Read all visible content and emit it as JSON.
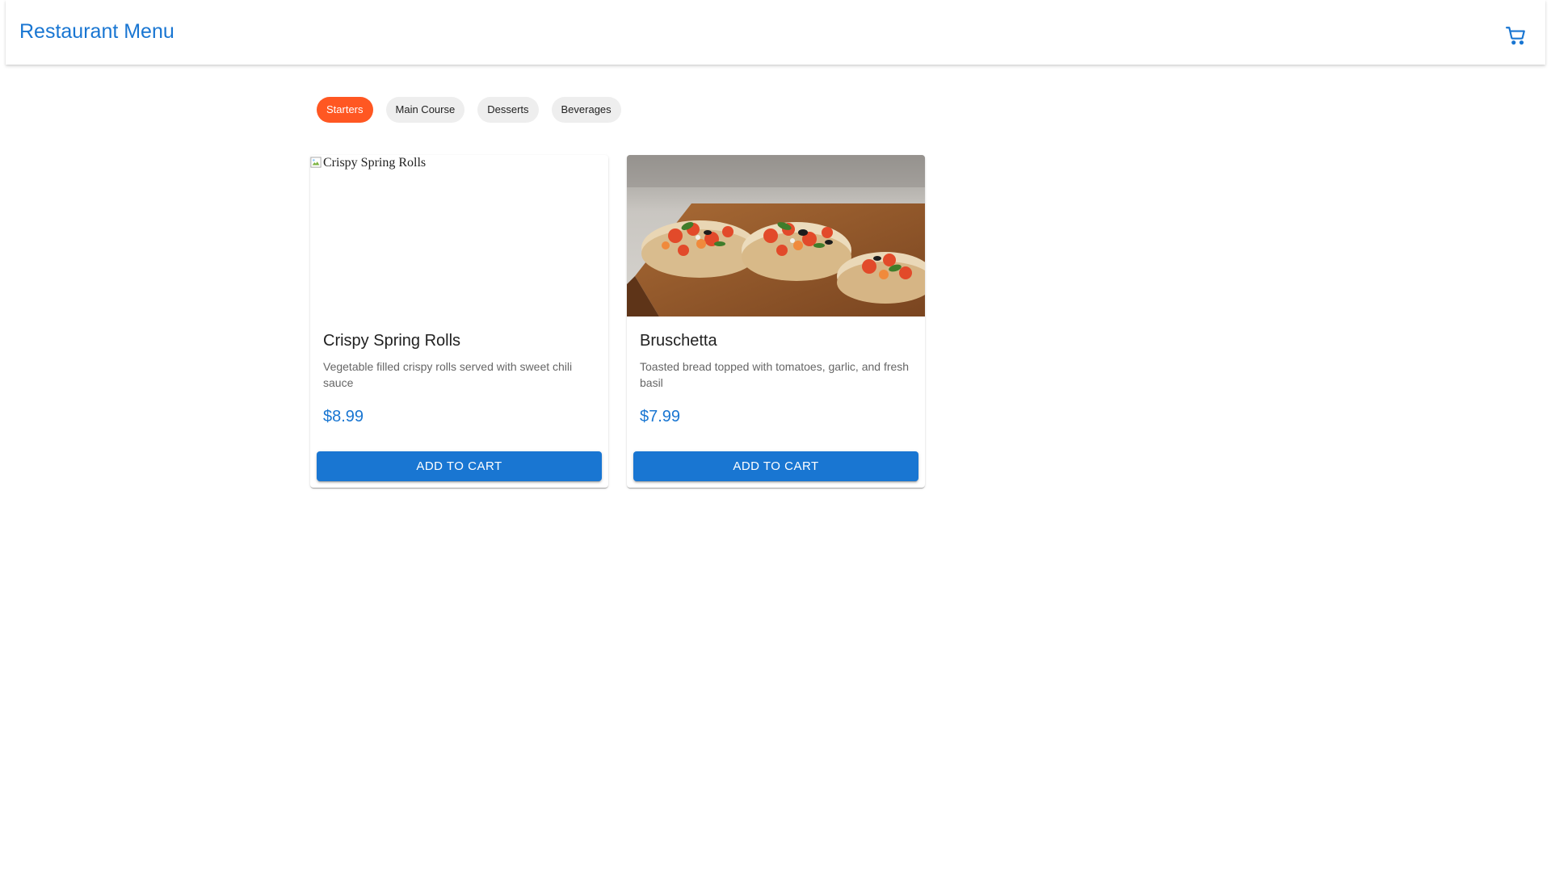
{
  "header": {
    "title": "Restaurant Menu",
    "cart_icon": "cart-icon"
  },
  "categories": [
    {
      "label": "Starters",
      "active": true
    },
    {
      "label": "Main Course",
      "active": false
    },
    {
      "label": "Desserts",
      "active": false
    },
    {
      "label": "Beverages",
      "active": false
    }
  ],
  "items": [
    {
      "image_alt": "Crispy Spring Rolls",
      "image_loaded": false,
      "name": "Crispy Spring Rolls",
      "description": "Vegetable filled crispy rolls served with sweet chili sauce",
      "price": "$8.99",
      "button_label": "ADD TO CART"
    },
    {
      "image_alt": "Bruschetta",
      "image_loaded": true,
      "name": "Bruschetta",
      "description": "Toasted bread topped with tomatoes, garlic, and fresh basil",
      "price": "$7.99",
      "button_label": "ADD TO CART"
    }
  ],
  "colors": {
    "primary": "#1976d2",
    "chip_active": "#ff5722",
    "chip_inactive": "#eeeeee"
  }
}
